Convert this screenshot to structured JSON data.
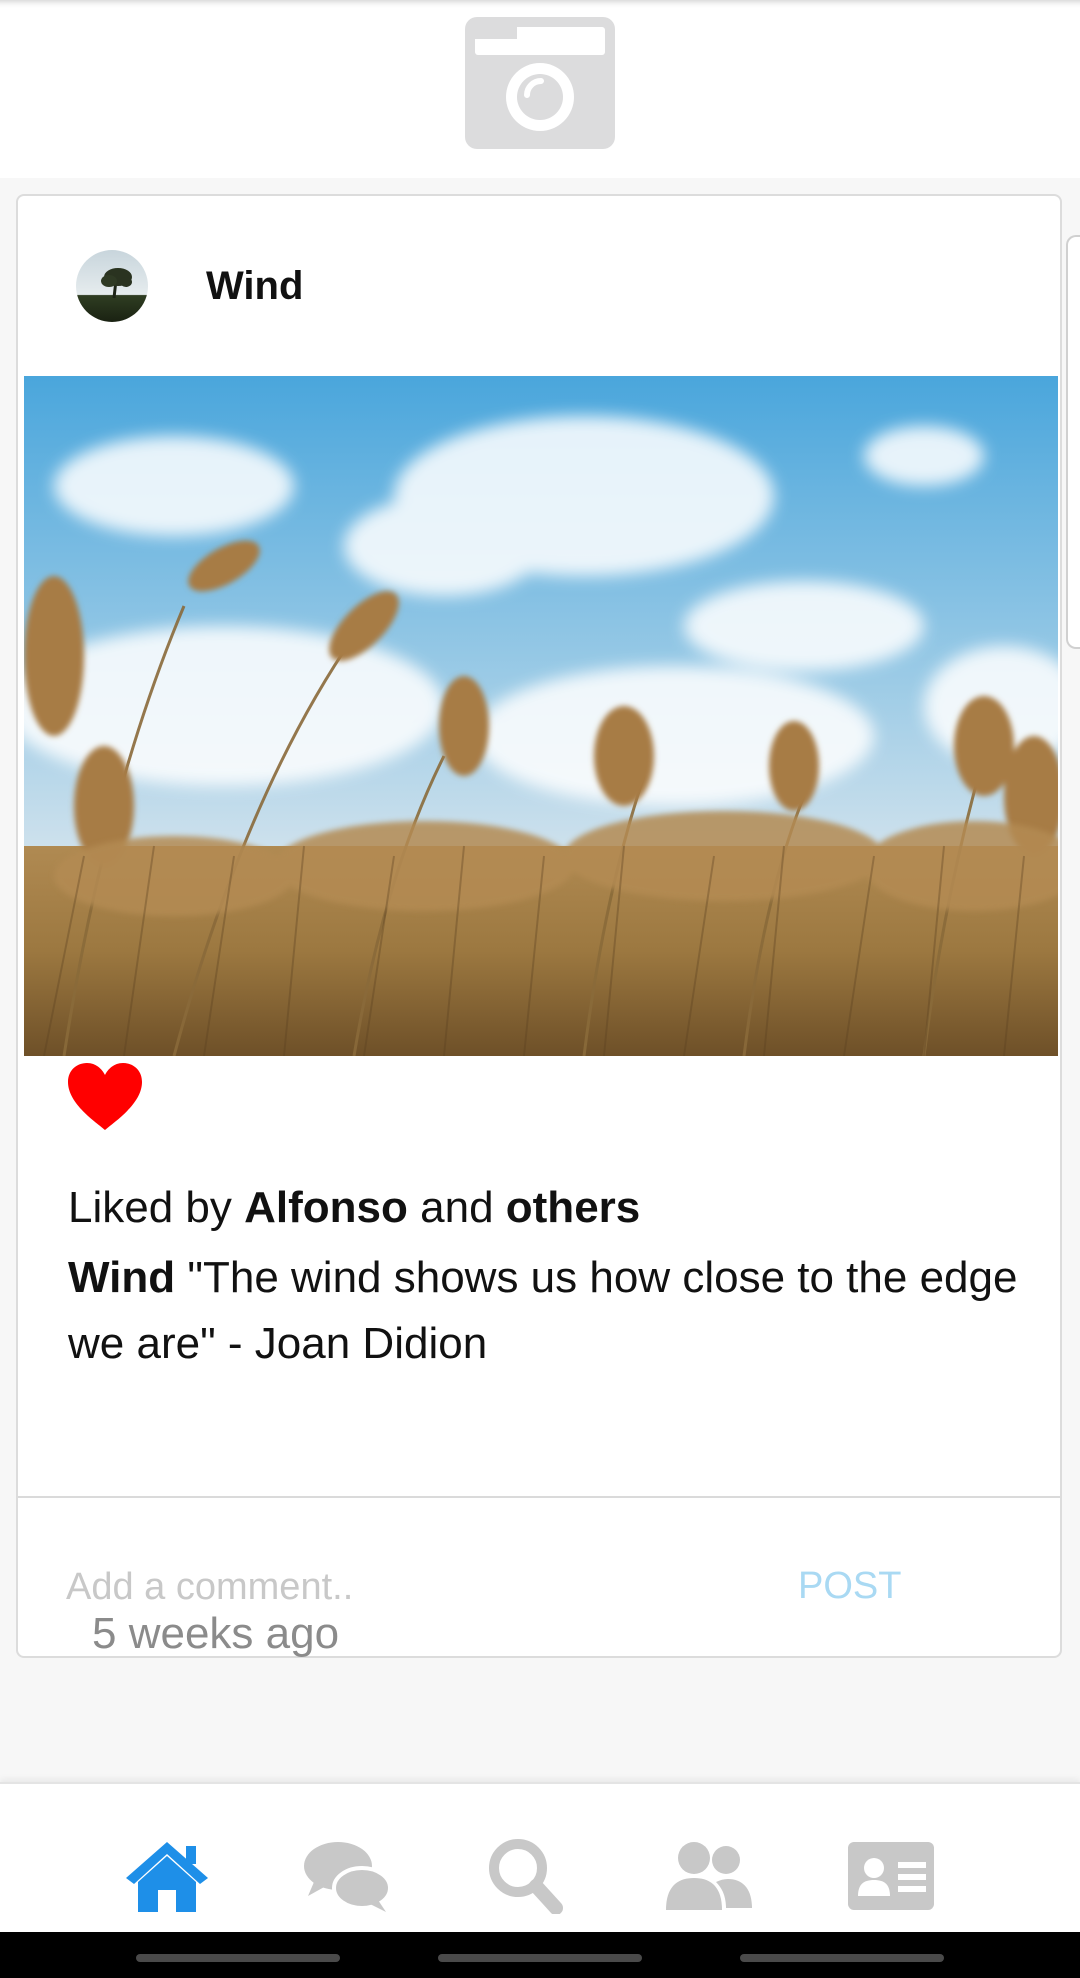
{
  "header": {
    "icon": "camera-icon"
  },
  "post": {
    "author": "Wind",
    "avatar_icon": "tree-avatar",
    "like_icon": "heart-icon",
    "liked_by_prefix": "Liked by",
    "liked_by_user": "Alfonso",
    "liked_by_and": "and",
    "liked_by_others": "others",
    "caption_author": "Wind",
    "caption_text": "\"The wind shows us how close to the edge we are\" - Joan Didion",
    "timestamp": "5 weeks ago"
  },
  "comment": {
    "placeholder": "Add a comment..",
    "post_label": "POST"
  },
  "nav": {
    "items": [
      {
        "icon": "home-icon",
        "active": true
      },
      {
        "icon": "chat-icon",
        "active": false
      },
      {
        "icon": "search-icon",
        "active": false
      },
      {
        "icon": "users-icon",
        "active": false
      },
      {
        "icon": "profile-card-icon",
        "active": false
      }
    ]
  },
  "colors": {
    "accent": "#1e8fe8",
    "inactive_icon": "#c8c8c8",
    "heart": "#ff0000",
    "post_button": "#a9d9f3"
  }
}
